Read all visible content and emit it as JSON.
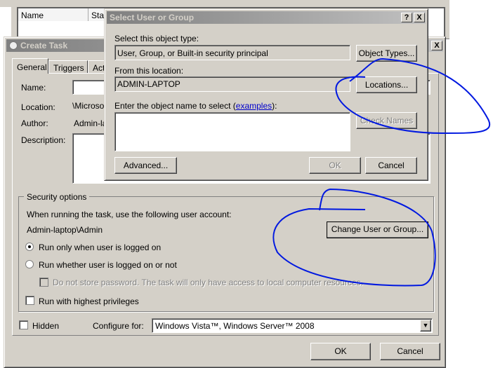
{
  "background": {
    "columns": [
      "Name",
      "Status"
    ]
  },
  "create_task": {
    "title": "Create Task",
    "tabs": [
      "General",
      "Triggers",
      "Actions"
    ],
    "name_label": "Name:",
    "name_value": "",
    "location_label": "Location:",
    "location_value": "\\Microsoft",
    "author_label": "Author:",
    "author_value": "Admin-laptop\\Admin",
    "description_label": "Description:",
    "security_group": "Security options",
    "run_as_text": "When running the task, use the following user account:",
    "account": "Admin-laptop\\Admin",
    "change_user_button": "Change User or Group...",
    "radio_logged_on": "Run only when user is logged on",
    "radio_whether": "Run whether user is logged on or not",
    "no_store_password": "Do not store password.  The task will only have access to local computer resources.",
    "highest_privileges": "Run with highest privileges",
    "hidden": "Hidden",
    "configure_for_label": "Configure for:",
    "configure_for_value": "Windows Vista™, Windows Server™ 2008",
    "ok": "OK",
    "cancel": "Cancel"
  },
  "select_user": {
    "title": "Select User or Group",
    "help": "?",
    "close": "X",
    "object_type_label": "Select this object type:",
    "object_type_value": "User, Group, or Built-in security principal",
    "object_types_button": "Object Types...",
    "location_label": "From this location:",
    "location_value": "ADMIN-LAPTOP",
    "locations_button": "Locations...",
    "enter_label": "Enter the object name to select (",
    "examples_link": "examples",
    "enter_label_end": "):",
    "check_names_button": "Check Names",
    "advanced_button": "Advanced...",
    "ok": "OK",
    "cancel": "Cancel"
  },
  "annotation_color": "#0018e0"
}
